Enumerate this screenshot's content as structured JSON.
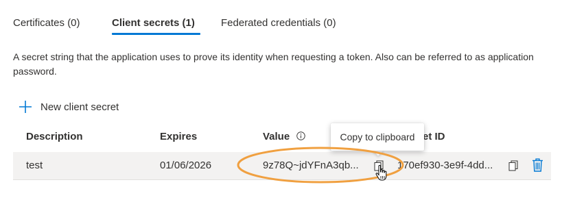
{
  "tabs": [
    {
      "label": "Certificates (0)",
      "active": false
    },
    {
      "label": "Client secrets (1)",
      "active": true
    },
    {
      "label": "Federated credentials (0)",
      "active": false
    }
  ],
  "description": "A secret string that the application uses to prove its identity when requesting a token. Also can be referred to as application password.",
  "new_secret_label": "New client secret",
  "table": {
    "headers": {
      "description": "Description",
      "expires": "Expires",
      "value": "Value",
      "secret_id": "et ID"
    },
    "rows": [
      {
        "description": "test",
        "expires": "01/06/2026",
        "value": "9z78Q~jdYFnA3qb...",
        "secret_id": "170ef930-3e9f-4dd..."
      }
    ]
  },
  "tooltip": "Copy to clipboard",
  "colors": {
    "accent": "#0078d4",
    "highlight": "#f0a040",
    "row_bg": "#f3f2f1"
  },
  "icons": {
    "add": "plus-icon",
    "info": "info-icon",
    "copy": "copy-icon",
    "delete": "trash-icon",
    "pointer": "hand-cursor-icon"
  }
}
